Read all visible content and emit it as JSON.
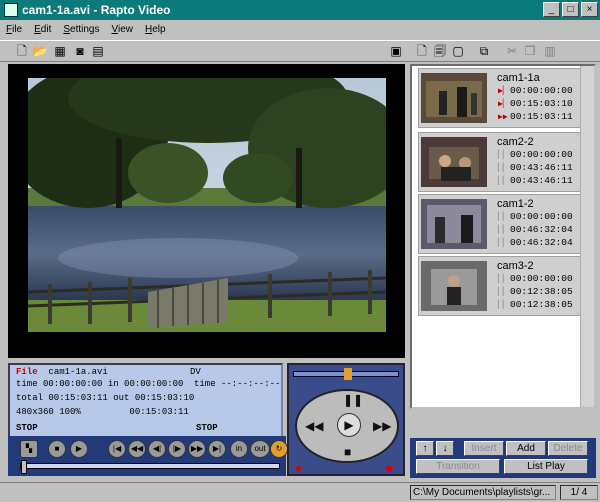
{
  "window": {
    "title": "cam1-1a.avi - Rapto Video",
    "min": "_",
    "max": "□",
    "close": "×"
  },
  "menu": [
    "File",
    "Edit",
    "Settings",
    "View",
    "Help"
  ],
  "clips": [
    {
      "name": "cam1-1a",
      "tc": [
        "00:00:00:00",
        "00:15:03:10",
        "00:15:03:11"
      ]
    },
    {
      "name": "cam2-2",
      "tc": [
        "00:00:00:00",
        "00:43:46:11",
        "00:43:46:11"
      ]
    },
    {
      "name": "cam1-2",
      "tc": [
        "00:00:00:00",
        "00:46:32:04",
        "00:46:32:04"
      ]
    },
    {
      "name": "cam3-2",
      "tc": [
        "00:00:00:00",
        "00:12:38:05",
        "00:12:38:05"
      ]
    }
  ],
  "info": {
    "file_label": "File",
    "file_value": "cam1-1a.avi",
    "format": "DV",
    "time_label": "time 00:00:00:00",
    "in_label": "in",
    "in_value": "00:00:00:00",
    "time2": "time --:--:--:--",
    "total": "total 00:15:03:11",
    "out": "out 00:15:03:10",
    "res": "480x360 100%",
    "len": "00:15:03:11",
    "stop1": "STOP",
    "stop2": "STOP"
  },
  "transport": {
    "in": "in",
    "out": "out",
    "progress": 0
  },
  "buttons": {
    "insert": "Insert",
    "add": "Add",
    "delete": "Delete",
    "transition": "Transition",
    "listplay": "List Play"
  },
  "status": {
    "path": "C:\\My Documents\\playlists\\gr...",
    "page": "1/ 4"
  }
}
